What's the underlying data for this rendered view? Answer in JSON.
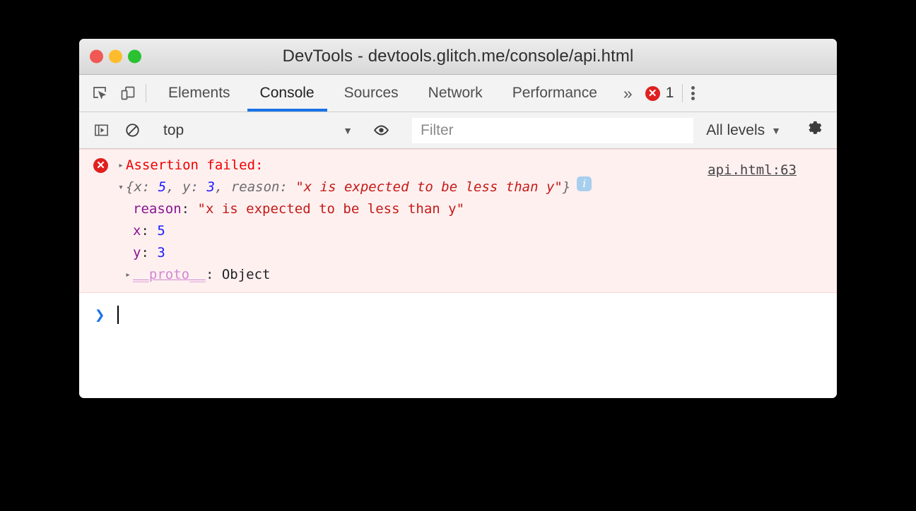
{
  "window": {
    "title": "DevTools - devtools.glitch.me/console/api.html",
    "traffic_lights": [
      {
        "name": "close",
        "color": "#f15853"
      },
      {
        "name": "minimize",
        "color": "#fdbc2d"
      },
      {
        "name": "zoom",
        "color": "#2bc231"
      }
    ]
  },
  "tabbar": {
    "icons": [
      {
        "name": "inspect-element-icon",
        "label": "Inspect element"
      },
      {
        "name": "device-toolbar-icon",
        "label": "Toggle device toolbar"
      }
    ],
    "tabs": [
      {
        "label": "Elements",
        "active": false
      },
      {
        "label": "Console",
        "active": true
      },
      {
        "label": "Sources",
        "active": false
      },
      {
        "label": "Network",
        "active": false
      },
      {
        "label": "Performance",
        "active": false
      }
    ],
    "more_label": "»",
    "error_count": "1",
    "error_icon_glyph": "✕",
    "menu_label": "More options"
  },
  "console_toolbar": {
    "sidebar_toggle": "console-sidebar-icon",
    "clear_console": "clear-console-icon",
    "context": {
      "value": "top",
      "caret": "▼"
    },
    "live_expression": "eye-icon",
    "filter": {
      "placeholder": "Filter",
      "value": ""
    },
    "levels": {
      "label": "All levels",
      "caret": "▼"
    },
    "settings": "gear-icon"
  },
  "console": {
    "messages": [
      {
        "type": "error",
        "disclosure": "▸",
        "text": "Assertion failed:",
        "source": "api.html:63",
        "preview": {
          "disclosure": "▾",
          "open_brace": "{",
          "entries": [
            {
              "key": "x",
              "sep": ": ",
              "value": "5",
              "kind": "number"
            },
            {
              "key": "y",
              "sep": ": ",
              "value": "3",
              "kind": "number"
            },
            {
              "key": "reason",
              "sep": ": ",
              "value": "\"x is expected to be less than y\"",
              "kind": "string"
            }
          ],
          "separator": ", ",
          "close_brace": "}",
          "info_badge": "i"
        },
        "properties": [
          {
            "key": "reason",
            "sep": ": ",
            "value": "\"x is expected to be less than y\"",
            "kind": "string"
          },
          {
            "key": "x",
            "sep": ": ",
            "value": "5",
            "kind": "number"
          },
          {
            "key": "y",
            "sep": ": ",
            "value": "3",
            "kind": "number"
          }
        ],
        "proto": {
          "disclosure": "▸",
          "key": "__proto__",
          "sep": ": ",
          "value": "Object"
        }
      }
    ],
    "prompt": {
      "chevron": "❯",
      "input_value": ""
    }
  },
  "colors": {
    "error_bg": "#fff0f0",
    "error_text": "#ef0000",
    "accent_blue": "#1a73e8",
    "key_purple": "#881391",
    "string_red": "#c41a16",
    "number_blue": "#1a1aff",
    "proto_purple": "#d287d2",
    "info_badge_blue": "#a8ceee"
  }
}
